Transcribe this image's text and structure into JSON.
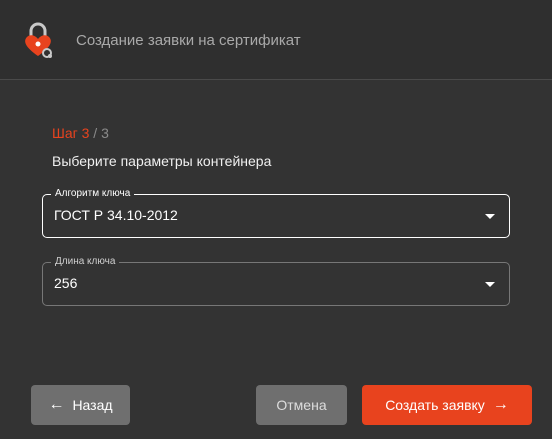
{
  "window": {
    "title": "Создание заявки на сертификат",
    "icon": "lock-heart-icon"
  },
  "wizard": {
    "step_current": "Шаг 3",
    "step_total": " / 3",
    "heading": "Выберите параметры контейнера"
  },
  "fields": {
    "algorithm": {
      "label": "Алгоритм ключа",
      "value": "ГОСТ Р 34.10-2012"
    },
    "key_length": {
      "label": "Длина ключа",
      "value": "256"
    }
  },
  "buttons": {
    "back": "Назад",
    "cancel": "Отмена",
    "create": "Создать заявку"
  },
  "colors": {
    "accent": "#e8431e",
    "background": "#333333",
    "button_gray": "#6f6f6f"
  }
}
